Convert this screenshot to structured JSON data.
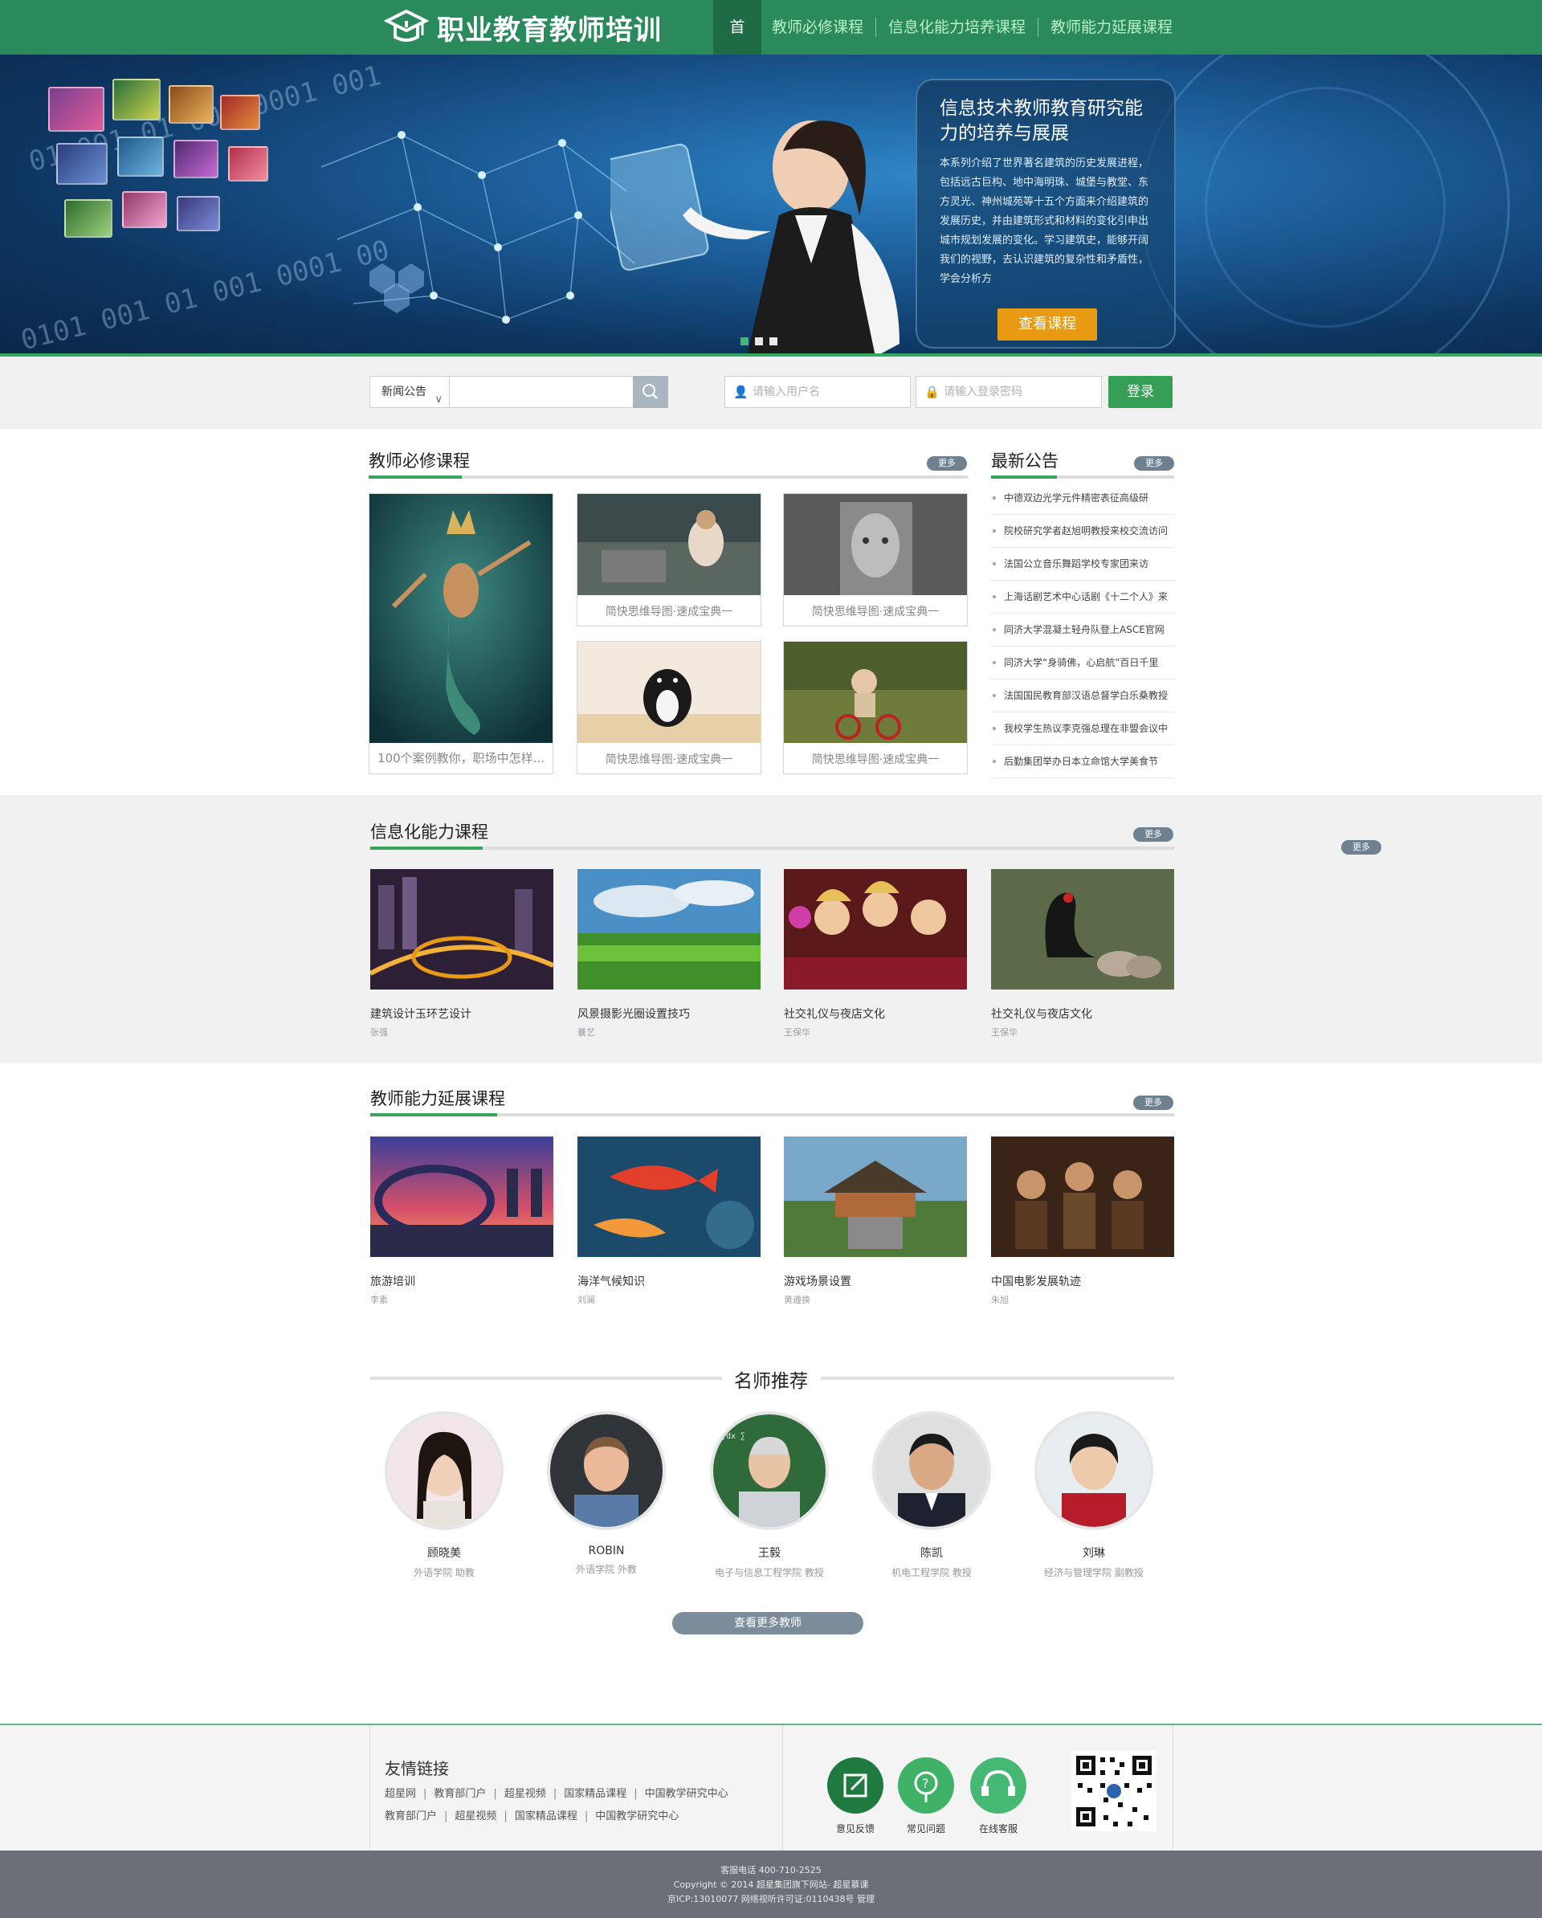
{
  "header": {
    "logo_text": "职业教育教师培训",
    "nav": [
      "首页",
      "教师必修课程",
      "信息化能力培养课程",
      "教师能力延展课程"
    ]
  },
  "banner": {
    "binary_text": [
      "01 001 01 001 0001 001",
      "0101 001 01 001 0001 00"
    ],
    "panel_title": "信息技术教师教育研究能力的培养与展展",
    "panel_desc": "本系列介绍了世界著名建筑的历史发展进程，包括远古巨构、地中海明珠、城堡与教堂、东方灵光、神州城苑等十五个方面来介绍建筑的发展历史，并由建筑形式和材料的变化引申出城市规划发展的变化。学习建筑史，能够开阔我们的视野，去认识建筑的复杂性和矛盾性，学会分析方",
    "panel_button": "查看课程",
    "slides": 3,
    "active_slide": 0
  },
  "search": {
    "category": "新闻公告",
    "search_placeholder": "",
    "username_placeholder": "请输入用户名",
    "password_placeholder": "请输入登录密码",
    "login_button": "登录"
  },
  "required": {
    "title": "教师必修课程",
    "more": "更多",
    "feature_caption": "100个案例教你，职场中怎样...",
    "items": [
      "简快思维导图·速成宝典一",
      "简快思维导图·速成宝典一",
      "简快思维导图·速成宝典一",
      "简快思维导图·速成宝典一"
    ]
  },
  "news": {
    "title": "最新公告",
    "more": "更多",
    "items": [
      "中德双边光学元件精密表征高级研",
      "院校研究学者赵旭明教授来校交流访问",
      "法国公立音乐舞蹈学校专家团来访",
      "上海话剧艺术中心话剧《十二个人》来",
      "同济大学混凝土轻舟队登上ASCE官网",
      "同济大学“身骑佛，心启航”百日千里",
      "法国国民教育部汉语总督学白乐桑教授",
      "我校学生热议李克强总理在非盟会议中",
      "后勤集团举办日本立命馆大学美食节"
    ]
  },
  "info_courses": {
    "title": "信息化能力课程",
    "more": "更多",
    "side_more": "更多",
    "items": [
      {
        "title": "建筑设计玉环艺设计",
        "author": "张强"
      },
      {
        "title": "风景摄影光圈设置技巧",
        "author": "曩艺"
      },
      {
        "title": "社交礼仪与夜店文化",
        "author": "王保华"
      },
      {
        "title": "社交礼仪与夜店文化",
        "author": "王保华"
      }
    ]
  },
  "extend_courses": {
    "title": "教师能力延展课程",
    "more": "更多",
    "items": [
      {
        "title": "旅游培训",
        "author": "李素"
      },
      {
        "title": "海洋气候知识",
        "author": "刘澜"
      },
      {
        "title": "游戏场景设置",
        "author": "黄遵换"
      },
      {
        "title": "中国电影发展轨迹",
        "author": "朱旭"
      }
    ]
  },
  "teachers": {
    "title": "名师推荐",
    "more_button": "查看更多教师",
    "items": [
      {
        "name": "顾晓美",
        "info": "外语学院 助教"
      },
      {
        "name": "ROBIN",
        "info": "外语学院 外教"
      },
      {
        "name": "王毅",
        "info": "电子与信息工程学院 教授"
      },
      {
        "name": "陈凯",
        "info": "机电工程学院 教授"
      },
      {
        "name": "刘琳",
        "info": "经济与管理学院 副教授"
      }
    ]
  },
  "footer": {
    "friend_title": "友情链接",
    "links_row1": [
      "超星网",
      "教育部门户",
      "超星视频",
      "国家精品课程",
      "中国教学研究中心"
    ],
    "links_row2": [
      "教育部门户",
      "超星视频",
      "国家精品课程",
      "中国教学研究中心"
    ],
    "buttons": [
      "意见反馈",
      "常见问题",
      "在线客服"
    ],
    "line1": "客服电话 400-710-2525",
    "line2": "Copyright © 2014 超星集团旗下网站- 超星慕课",
    "line3": "京ICP:13010077 网络视听许可证:0110438号    管理"
  },
  "colors": {
    "brand_green": "#2a8a5c",
    "accent_green": "#35a055",
    "orange": "#e89a13",
    "more_grey": "#6f8191"
  }
}
